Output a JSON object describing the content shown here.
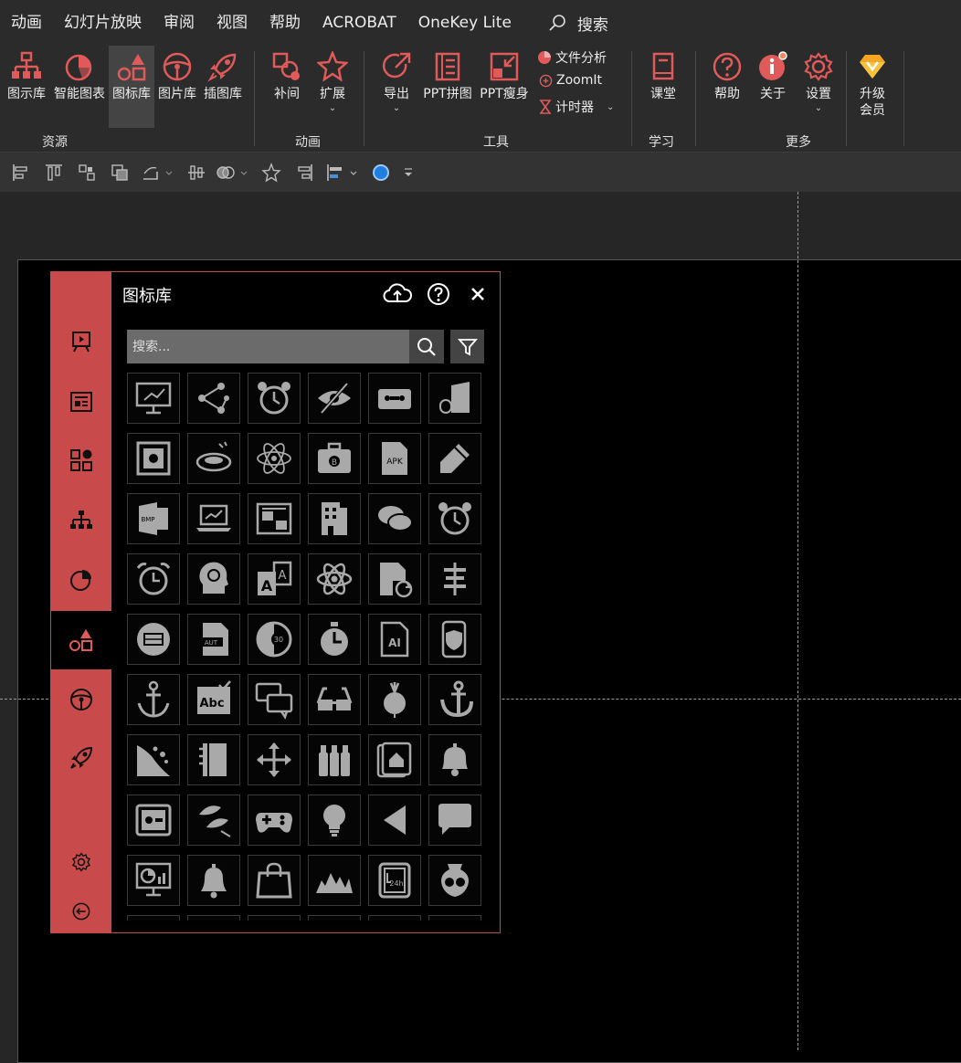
{
  "menu": {
    "tabs": [
      "动画",
      "幻灯片放映",
      "审阅",
      "视图",
      "帮助",
      "ACROBAT",
      "OneKey Lite"
    ],
    "search_label": "搜索"
  },
  "ribbon": {
    "resources": {
      "group_label": "资源",
      "buttons": [
        "图示库",
        "智能图表",
        "图标库",
        "图片库",
        "插图库"
      ],
      "active": "图标库"
    },
    "animation": {
      "group_label": "动画",
      "buttons": [
        "补间",
        "扩展"
      ]
    },
    "tools": {
      "group_label": "工具",
      "buttons": [
        "导出",
        "PPT拼图",
        "PPT瘦身"
      ],
      "small_items": [
        "文件分析",
        "ZoomIt",
        "计时器"
      ]
    },
    "study": {
      "group_label": "学习",
      "buttons": [
        "课堂"
      ]
    },
    "more": {
      "group_label": "更多",
      "buttons": [
        "帮助",
        "关于",
        "设置"
      ],
      "upgrade_line1": "升级",
      "upgrade_line2": "会员"
    }
  },
  "panel": {
    "title": "图标库",
    "search_placeholder": "搜索...",
    "sidebar_items": [
      "slideshow-icon",
      "news-icon",
      "apps-icon",
      "hierarchy-icon",
      "pie-icon",
      "shapes-icon",
      "steering-icon",
      "rocket-icon"
    ],
    "sidebar_active": "shapes-icon",
    "icons": [
      "presentation-chart",
      "share-nodes",
      "alarm-clock",
      "eye-slash",
      "cassette-tape",
      "mouse-bag",
      "safe-box",
      "fish-bowl",
      "atom-science",
      "bitcoin-briefcase",
      "apk-file",
      "pencil-eraser",
      "bmp-file",
      "laptop-chart",
      "image-document",
      "office-building",
      "chat-bubbles",
      "alarm-clock-2",
      "alarm-clock-3",
      "idea-head",
      "font-letters",
      "atom",
      "file-refresh",
      "signpost",
      "ticket-circle",
      "aut-file",
      "timer-30",
      "stopwatch",
      "ai-file",
      "phone-shield",
      "anchor",
      "spell-check",
      "chat-double",
      "3d-glasses",
      "radish",
      "anchor-2",
      "landslide",
      "notebook",
      "move-arrows",
      "bottles",
      "home-book",
      "bell",
      "safe",
      "feathers",
      "gamepad",
      "light-bulb",
      "triangle-left",
      "speech-bubble",
      "dashboard-monitor",
      "bell-2",
      "shopping-bag",
      "mountains",
      "24h-clock",
      "vase"
    ]
  },
  "colors": {
    "accent": "#c94a4a",
    "ribbon_bg": "#2b2b2b",
    "icon_gray": "#a9a9a9"
  }
}
